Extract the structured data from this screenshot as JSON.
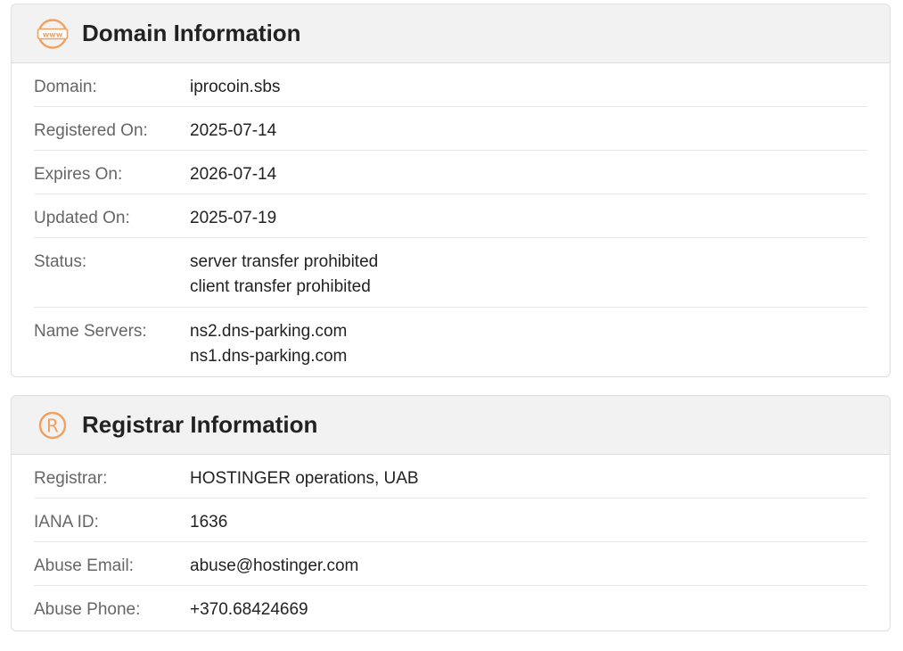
{
  "domain_info": {
    "title": "Domain Information",
    "icon": "www-icon",
    "rows": [
      {
        "label": "Domain:",
        "values": [
          "iprocoin.sbs"
        ]
      },
      {
        "label": "Registered On:",
        "values": [
          "2025-07-14"
        ]
      },
      {
        "label": "Expires On:",
        "values": [
          "2026-07-14"
        ]
      },
      {
        "label": "Updated On:",
        "values": [
          "2025-07-19"
        ]
      },
      {
        "label": "Status:",
        "values": [
          "server transfer prohibited",
          "client transfer prohibited"
        ]
      },
      {
        "label": "Name Servers:",
        "values": [
          "ns2.dns-parking.com",
          "ns1.dns-parking.com"
        ]
      }
    ]
  },
  "registrar_info": {
    "title": "Registrar Information",
    "icon": "registered-icon",
    "rows": [
      {
        "label": "Registrar:",
        "values": [
          "HOSTINGER operations, UAB"
        ]
      },
      {
        "label": "IANA ID:",
        "values": [
          "1636"
        ]
      },
      {
        "label": "Abuse Email:",
        "values": [
          "abuse@hostinger.com"
        ]
      },
      {
        "label": "Abuse Phone:",
        "values": [
          "+370.68424669"
        ]
      }
    ]
  },
  "colors": {
    "accent": "#f0a060",
    "header_bg": "#f2f2f2",
    "border": "#dedede"
  }
}
